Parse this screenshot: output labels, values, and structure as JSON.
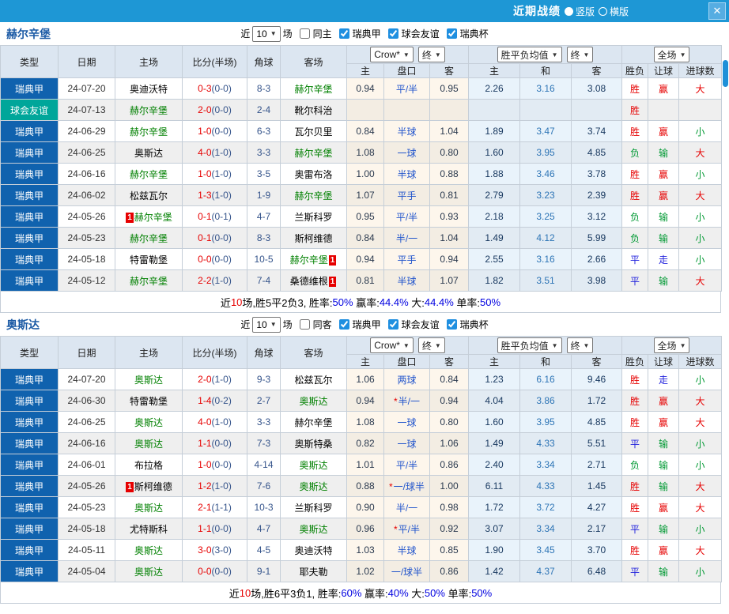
{
  "titlebar": {
    "title": "近期战绩",
    "radios": [
      {
        "label": "竖版",
        "checked": true
      },
      {
        "label": "横版",
        "checked": false
      }
    ],
    "close_icon": "✕"
  },
  "filter_labels": {
    "near": "近",
    "count": "10",
    "games": "场",
    "leagues": [
      "瑞典甲",
      "球会友谊",
      "瑞典杯"
    ]
  },
  "table_header": {
    "type": "类型",
    "date": "日期",
    "home": "主场",
    "score": "比分(半场)",
    "corner": "角球",
    "away": "客场",
    "dd_crow": "Crow*",
    "dd_final": "终",
    "dd_avg": "胜平负均值",
    "dd_scope": "全场",
    "sub_home": "主",
    "sub_line": "盘口",
    "sub_away": "客",
    "sub_h": "主",
    "sub_d": "和",
    "sub_a": "客",
    "sub_wdl": "胜负",
    "sub_rg": "让球",
    "sub_goals": "进球数"
  },
  "colors": {
    "titlebar_blue": "#1e97d5",
    "league_blue": "#1062ae",
    "league_teal": "#00a69a",
    "focal_team_green": "#008000",
    "score_red": "#e60000",
    "result_red": "#e60000",
    "result_green": "#009933",
    "result_blue": "#2222dd",
    "euro_mid_blue": "#2e75b6"
  },
  "sections": [
    {
      "team": "赫尔辛堡",
      "same_label": "同主",
      "same_checked": false,
      "league_checked": [
        true,
        true,
        true
      ],
      "summary": {
        "t1": "近",
        "count": "10",
        "t2": "场,胜5平2负3, 胜率:",
        "win": "50%",
        "t3": " 赢率:",
        "rg": "44.4%",
        "t4": " 大:",
        "big": "44.4%",
        "t5": " 单率:",
        "single": "50%"
      },
      "rows": [
        {
          "lg": "瑞典甲",
          "lgc": "blue",
          "date": "24-07-20",
          "home": {
            "name": "奥迪沃特",
            "focal": false
          },
          "ft": "0-3",
          "ht": "(0-0)",
          "corner": "8-3",
          "away": {
            "name": "赫尔辛堡",
            "focal": true
          },
          "ah": [
            "0.94",
            "平/半",
            "0.95"
          ],
          "eu": [
            "2.26",
            "3.16",
            "3.08"
          ],
          "res": [
            [
              "胜",
              "r"
            ],
            [
              "赢",
              "r"
            ],
            [
              "大",
              "r"
            ]
          ]
        },
        {
          "lg": "球会友谊",
          "lgc": "teal",
          "date": "24-07-13",
          "home": {
            "name": "赫尔辛堡",
            "focal": true
          },
          "ft": "2-0",
          "ht": "(0-0)",
          "corner": "2-4",
          "away": {
            "name": "靴尔科治",
            "focal": false
          },
          "ah": null,
          "eu": null,
          "res": [
            [
              "胜",
              "r"
            ],
            null,
            null
          ]
        },
        {
          "lg": "瑞典甲",
          "lgc": "blue",
          "date": "24-06-29",
          "home": {
            "name": "赫尔辛堡",
            "focal": true
          },
          "ft": "1-0",
          "ht": "(0-0)",
          "corner": "6-3",
          "away": {
            "name": "瓦尔贝里",
            "focal": false
          },
          "ah": [
            "0.84",
            "半球",
            "1.04"
          ],
          "eu": [
            "1.89",
            "3.47",
            "3.74"
          ],
          "res": [
            [
              "胜",
              "r"
            ],
            [
              "赢",
              "r"
            ],
            [
              "小",
              "g"
            ]
          ]
        },
        {
          "lg": "瑞典甲",
          "lgc": "blue",
          "date": "24-06-25",
          "home": {
            "name": "奥斯达",
            "focal": false
          },
          "ft": "4-0",
          "ht": "(1-0)",
          "corner": "3-3",
          "away": {
            "name": "赫尔辛堡",
            "focal": true
          },
          "ah": [
            "1.08",
            "一球",
            "0.80"
          ],
          "eu": [
            "1.60",
            "3.95",
            "4.85"
          ],
          "res": [
            [
              "负",
              "g"
            ],
            [
              "输",
              "g"
            ],
            [
              "大",
              "r"
            ]
          ]
        },
        {
          "lg": "瑞典甲",
          "lgc": "blue",
          "date": "24-06-16",
          "home": {
            "name": "赫尔辛堡",
            "focal": true
          },
          "ft": "1-0",
          "ht": "(1-0)",
          "corner": "3-5",
          "away": {
            "name": "奥雷布洛",
            "focal": false
          },
          "ah": [
            "1.00",
            "半球",
            "0.88"
          ],
          "eu": [
            "1.88",
            "3.46",
            "3.78"
          ],
          "res": [
            [
              "胜",
              "r"
            ],
            [
              "赢",
              "r"
            ],
            [
              "小",
              "g"
            ]
          ]
        },
        {
          "lg": "瑞典甲",
          "lgc": "blue",
          "date": "24-06-02",
          "home": {
            "name": "松兹瓦尔",
            "focal": false
          },
          "ft": "1-3",
          "ht": "(1-0)",
          "corner": "1-9",
          "away": {
            "name": "赫尔辛堡",
            "focal": true
          },
          "ah": [
            "1.07",
            "平手",
            "0.81"
          ],
          "eu": [
            "2.79",
            "3.23",
            "2.39"
          ],
          "res": [
            [
              "胜",
              "r"
            ],
            [
              "赢",
              "r"
            ],
            [
              "大",
              "r"
            ]
          ]
        },
        {
          "lg": "瑞典甲",
          "lgc": "blue",
          "date": "24-05-26",
          "home": {
            "name": "赫尔辛堡",
            "focal": true,
            "badge": "pre",
            "badge_text": "1"
          },
          "ft": "0-1",
          "ht": "(0-1)",
          "corner": "4-7",
          "away": {
            "name": "兰斯科罗",
            "focal": false
          },
          "ah": [
            "0.95",
            "平/半",
            "0.93"
          ],
          "eu": [
            "2.18",
            "3.25",
            "3.12"
          ],
          "res": [
            [
              "负",
              "g"
            ],
            [
              "输",
              "g"
            ],
            [
              "小",
              "g"
            ]
          ]
        },
        {
          "lg": "瑞典甲",
          "lgc": "blue",
          "date": "24-05-23",
          "home": {
            "name": "赫尔辛堡",
            "focal": true
          },
          "ft": "0-1",
          "ht": "(0-0)",
          "corner": "8-3",
          "away": {
            "name": "斯柯维德",
            "focal": false
          },
          "ah": [
            "0.84",
            "半/一",
            "1.04"
          ],
          "eu": [
            "1.49",
            "4.12",
            "5.99"
          ],
          "res": [
            [
              "负",
              "g"
            ],
            [
              "输",
              "g"
            ],
            [
              "小",
              "g"
            ]
          ]
        },
        {
          "lg": "瑞典甲",
          "lgc": "blue",
          "date": "24-05-18",
          "home": {
            "name": "特雷勒堡",
            "focal": false
          },
          "ft": "0-0",
          "ht": "(0-0)",
          "corner": "10-5",
          "away": {
            "name": "赫尔辛堡",
            "focal": true,
            "badge": "post",
            "badge_text": "1"
          },
          "ah": [
            "0.94",
            "平手",
            "0.94"
          ],
          "eu": [
            "2.55",
            "3.16",
            "2.66"
          ],
          "res": [
            [
              "平",
              "b"
            ],
            [
              "走",
              "b"
            ],
            [
              "小",
              "g"
            ]
          ]
        },
        {
          "lg": "瑞典甲",
          "lgc": "blue",
          "date": "24-05-12",
          "home": {
            "name": "赫尔辛堡",
            "focal": true
          },
          "ft": "2-2",
          "ht": "(1-0)",
          "corner": "7-4",
          "away": {
            "name": "桑德维根",
            "focal": false,
            "badge": "post",
            "badge_text": "1"
          },
          "ah": [
            "0.81",
            "半球",
            "1.07"
          ],
          "eu": [
            "1.82",
            "3.51",
            "3.98"
          ],
          "res": [
            [
              "平",
              "b"
            ],
            [
              "输",
              "g"
            ],
            [
              "大",
              "r"
            ]
          ]
        }
      ]
    },
    {
      "team": "奥斯达",
      "same_label": "同客",
      "same_checked": false,
      "league_checked": [
        true,
        true,
        true
      ],
      "summary": {
        "t1": "近",
        "count": "10",
        "t2": "场,胜6平3负1, 胜率:",
        "win": "60%",
        "t3": " 赢率:",
        "rg": "40%",
        "t4": " 大:",
        "big": "50%",
        "t5": " 单率:",
        "single": "50%"
      },
      "rows": [
        {
          "lg": "瑞典甲",
          "lgc": "blue",
          "date": "24-07-20",
          "home": {
            "name": "奥斯达",
            "focal": true
          },
          "ft": "2-0",
          "ht": "(1-0)",
          "corner": "9-3",
          "away": {
            "name": "松兹瓦尔",
            "focal": false
          },
          "ah": [
            "1.06",
            "两球",
            "0.84"
          ],
          "eu": [
            "1.23",
            "6.16",
            "9.46"
          ],
          "res": [
            [
              "胜",
              "r"
            ],
            [
              "走",
              "b"
            ],
            [
              "小",
              "g"
            ]
          ]
        },
        {
          "lg": "瑞典甲",
          "lgc": "blue",
          "date": "24-06-30",
          "home": {
            "name": "特雷勒堡",
            "focal": false
          },
          "ft": "1-4",
          "ht": "(0-2)",
          "corner": "2-7",
          "away": {
            "name": "奥斯达",
            "focal": true
          },
          "ah": [
            "0.94",
            "半/一",
            "0.94"
          ],
          "star": true,
          "eu": [
            "4.04",
            "3.86",
            "1.72"
          ],
          "res": [
            [
              "胜",
              "r"
            ],
            [
              "赢",
              "r"
            ],
            [
              "大",
              "r"
            ]
          ]
        },
        {
          "lg": "瑞典甲",
          "lgc": "blue",
          "date": "24-06-25",
          "home": {
            "name": "奥斯达",
            "focal": true
          },
          "ft": "4-0",
          "ht": "(1-0)",
          "corner": "3-3",
          "away": {
            "name": "赫尔辛堡",
            "focal": false
          },
          "ah": [
            "1.08",
            "一球",
            "0.80"
          ],
          "eu": [
            "1.60",
            "3.95",
            "4.85"
          ],
          "res": [
            [
              "胜",
              "r"
            ],
            [
              "赢",
              "r"
            ],
            [
              "大",
              "r"
            ]
          ]
        },
        {
          "lg": "瑞典甲",
          "lgc": "blue",
          "date": "24-06-16",
          "home": {
            "name": "奥斯达",
            "focal": true
          },
          "ft": "1-1",
          "ht": "(0-0)",
          "corner": "7-3",
          "away": {
            "name": "奥斯特桑",
            "focal": false
          },
          "ah": [
            "0.82",
            "一球",
            "1.06"
          ],
          "eu": [
            "1.49",
            "4.33",
            "5.51"
          ],
          "res": [
            [
              "平",
              "b"
            ],
            [
              "输",
              "g"
            ],
            [
              "小",
              "g"
            ]
          ]
        },
        {
          "lg": "瑞典甲",
          "lgc": "blue",
          "date": "24-06-01",
          "home": {
            "name": "布拉格",
            "focal": false
          },
          "ft": "1-0",
          "ht": "(0-0)",
          "corner": "4-14",
          "away": {
            "name": "奥斯达",
            "focal": true
          },
          "ah": [
            "1.01",
            "平/半",
            "0.86"
          ],
          "eu": [
            "2.40",
            "3.34",
            "2.71"
          ],
          "res": [
            [
              "负",
              "g"
            ],
            [
              "输",
              "g"
            ],
            [
              "小",
              "g"
            ]
          ]
        },
        {
          "lg": "瑞典甲",
          "lgc": "blue",
          "date": "24-05-26",
          "home": {
            "name": "斯柯维德",
            "focal": false,
            "badge": "pre",
            "badge_text": "1"
          },
          "ft": "1-2",
          "ht": "(1-0)",
          "corner": "7-6",
          "away": {
            "name": "奥斯达",
            "focal": true
          },
          "ah": [
            "0.88",
            "一/球半",
            "1.00"
          ],
          "star": true,
          "eu": [
            "6.11",
            "4.33",
            "1.45"
          ],
          "res": [
            [
              "胜",
              "r"
            ],
            [
              "输",
              "g"
            ],
            [
              "大",
              "r"
            ]
          ]
        },
        {
          "lg": "瑞典甲",
          "lgc": "blue",
          "date": "24-05-23",
          "home": {
            "name": "奥斯达",
            "focal": true
          },
          "ft": "2-1",
          "ht": "(1-1)",
          "corner": "10-3",
          "away": {
            "name": "兰斯科罗",
            "focal": false
          },
          "ah": [
            "0.90",
            "半/一",
            "0.98"
          ],
          "eu": [
            "1.72",
            "3.72",
            "4.27"
          ],
          "res": [
            [
              "胜",
              "r"
            ],
            [
              "赢",
              "r"
            ],
            [
              "大",
              "r"
            ]
          ]
        },
        {
          "lg": "瑞典甲",
          "lgc": "blue",
          "date": "24-05-18",
          "home": {
            "name": "尤特斯科",
            "focal": false
          },
          "ft": "1-1",
          "ht": "(0-0)",
          "corner": "4-7",
          "away": {
            "name": "奥斯达",
            "focal": true
          },
          "ah": [
            "0.96",
            "平/半",
            "0.92"
          ],
          "star": true,
          "eu": [
            "3.07",
            "3.34",
            "2.17"
          ],
          "res": [
            [
              "平",
              "b"
            ],
            [
              "输",
              "g"
            ],
            [
              "小",
              "g"
            ]
          ]
        },
        {
          "lg": "瑞典甲",
          "lgc": "blue",
          "date": "24-05-11",
          "home": {
            "name": "奥斯达",
            "focal": true
          },
          "ft": "3-0",
          "ht": "(3-0)",
          "corner": "4-5",
          "away": {
            "name": "奥迪沃特",
            "focal": false
          },
          "ah": [
            "1.03",
            "半球",
            "0.85"
          ],
          "eu": [
            "1.90",
            "3.45",
            "3.70"
          ],
          "res": [
            [
              "胜",
              "r"
            ],
            [
              "赢",
              "r"
            ],
            [
              "大",
              "r"
            ]
          ]
        },
        {
          "lg": "瑞典甲",
          "lgc": "blue",
          "date": "24-05-04",
          "home": {
            "name": "奥斯达",
            "focal": true
          },
          "ft": "0-0",
          "ht": "(0-0)",
          "corner": "9-1",
          "away": {
            "name": "耶夫勒",
            "focal": false
          },
          "ah": [
            "1.02",
            "一/球半",
            "0.86"
          ],
          "eu": [
            "1.42",
            "4.37",
            "6.48"
          ],
          "res": [
            [
              "平",
              "b"
            ],
            [
              "输",
              "g"
            ],
            [
              "小",
              "g"
            ]
          ]
        }
      ]
    }
  ]
}
